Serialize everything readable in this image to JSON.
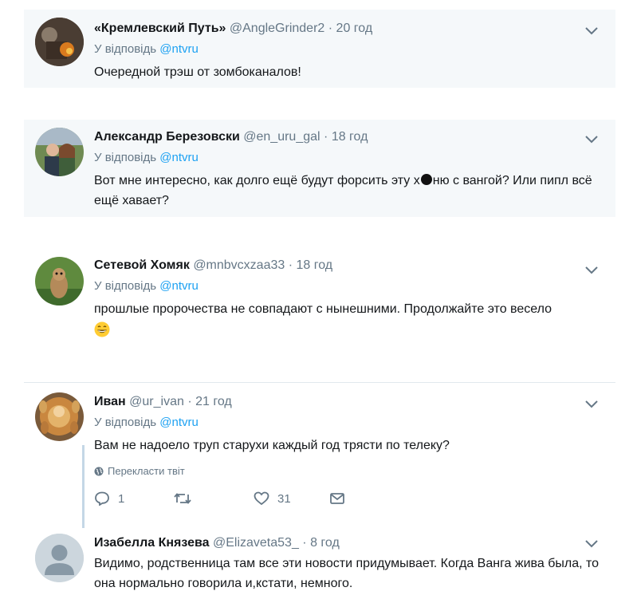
{
  "tweets": [
    {
      "name": "«Кремлевский Путь»",
      "handle": "@AngleGrinder2",
      "dot": "·",
      "time": "20 год",
      "reply_prefix": "У відповідь",
      "mention": "@ntvru",
      "text": "Очередной трэш от зомбоканалов!"
    },
    {
      "name": "Александр Березовски",
      "handle": "@en_uru_gal",
      "dot": "·",
      "time": "18 год",
      "reply_prefix": "У відповідь",
      "mention": "@ntvru",
      "text_before": "Вот мне интересно, как долго ещё будут форсить эту х",
      "text_after": "ню с вангой? Или пипл всё ещё хавает?"
    },
    {
      "name": "Сетевой Хомяк",
      "handle": "@mnbvcxzaa33",
      "dot": "·",
      "time": "18 год",
      "reply_prefix": "У відповідь",
      "mention": "@ntvru",
      "text": "прошлые пророчества не совпадают с нынешними. Продолжайте это весело"
    },
    {
      "name": "Иван",
      "handle": "@ur_ivan",
      "dot": "·",
      "time": "21 год",
      "reply_prefix": "У відповідь",
      "mention": "@ntvru",
      "text": "Вам не надоело труп старухи каждый год трясти по телеку?",
      "translate_label": "Перекласти твіт",
      "reply_count": "1",
      "retweet_count": "",
      "like_count": "31"
    },
    {
      "name": "Изабелла Князева",
      "handle": "@Elizaveta53_",
      "dot": "·",
      "time": "8 год",
      "text": "Видимо, родственница там все эти новости придумывает. Когда Ванга жива была, то она нормально говорила и,кстати, немного."
    }
  ],
  "colors": {
    "link": "#1da1f2",
    "muted": "#657786",
    "shaded_bg": "#f5f8fa",
    "thread_line": "#c4d7e6"
  },
  "icons": [
    "chevron-down-icon",
    "globe-icon",
    "reply-icon",
    "retweet-icon",
    "like-icon",
    "message-icon",
    "grin-emoji-icon",
    "default-avatar-icon"
  ]
}
